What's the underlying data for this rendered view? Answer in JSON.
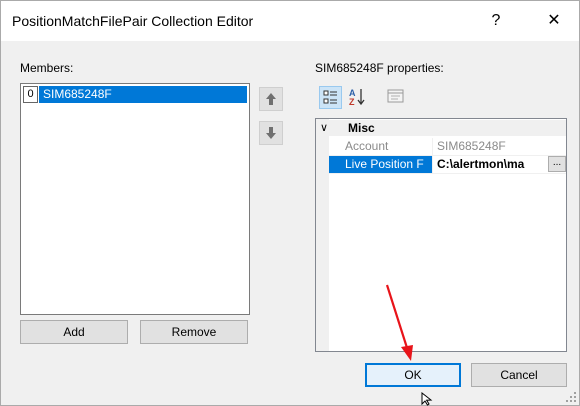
{
  "window": {
    "title": "PositionMatchFilePair Collection Editor",
    "help_glyph": "?",
    "close_glyph": "✕"
  },
  "members": {
    "label": "Members:",
    "items": [
      {
        "index": "0",
        "text": "SIM685248F"
      }
    ]
  },
  "buttons": {
    "add": "Add",
    "remove": "Remove",
    "ok": "OK",
    "cancel": "Cancel"
  },
  "properties": {
    "label": "SIM685248F properties:",
    "category": {
      "name": "Misc",
      "toggle": "∨"
    },
    "rows": [
      {
        "name": "Account",
        "value": "SIM685248F"
      },
      {
        "name": "Live Position F",
        "value": "C:\\alertmon\\ma",
        "button": "..."
      }
    ]
  },
  "icons": {
    "move_up": "arrow-up-icon",
    "move_down": "arrow-down-icon",
    "categorized": "categorized-icon",
    "alphabetical": "sort-az-icon",
    "property_pages": "property-pages-icon",
    "pointer": "red-arrow-annotation",
    "cursor": "mouse-cursor"
  },
  "colors": {
    "selection": "#0078d7",
    "annotation": "#e8141a"
  }
}
